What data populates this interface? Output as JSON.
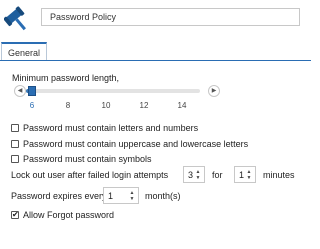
{
  "header": {
    "icon": "gavel-icon",
    "title": "Password Policy"
  },
  "tabs": [
    {
      "label": "General",
      "active": true
    }
  ],
  "min_length": {
    "label": "Minimum password length,",
    "ticks": [
      "6",
      "8",
      "10",
      "12",
      "14"
    ],
    "selected": "6",
    "left_arrow": "◀",
    "right_arrow": "▶"
  },
  "options": [
    {
      "label": "Password must contain letters and numbers",
      "checked": false
    },
    {
      "label": "Password must contain uppercase and lowercase letters",
      "checked": false
    },
    {
      "label": "Password must contain symbols",
      "checked": false
    }
  ],
  "lockout": {
    "prefix": "Lock out user after failed login attempts",
    "attempts": "3",
    "middle": "for",
    "minutes": "1",
    "suffix": "minutes"
  },
  "expiry": {
    "prefix": "Password expires every",
    "value": "1",
    "suffix": "month(s)"
  },
  "forgot": {
    "label": "Allow Forgot password",
    "checked": true
  },
  "spinner_up": "▲",
  "spinner_down": "▼",
  "check_mark": "✔"
}
